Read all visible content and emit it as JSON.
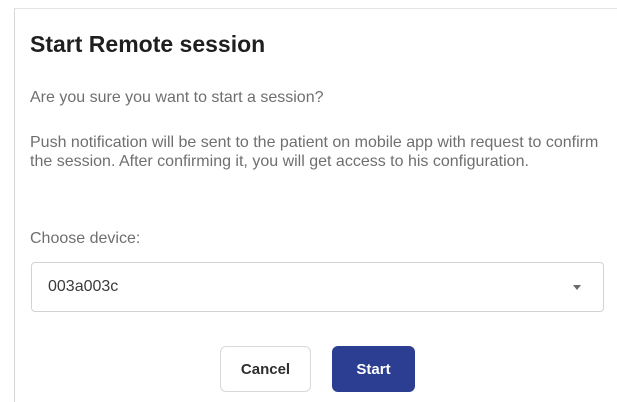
{
  "dialog": {
    "title": "Start Remote session",
    "question": "Are you sure you want to start a session?",
    "info": "Push notification will be sent to the patient on mobile app with request to confirm the session. After confirming it, you will get access to his configuration.",
    "device_label": "Choose device:",
    "device_select": {
      "selected_value": "003a003c",
      "arrow_icon": "chevron-down-icon"
    },
    "cancel_label": "Cancel",
    "start_label": "Start"
  },
  "colors": {
    "primary_button": "#2c3e92",
    "title_text": "#1f1f1f",
    "secondary_text": "#6f6f6f",
    "border": "#d2d2d2"
  }
}
